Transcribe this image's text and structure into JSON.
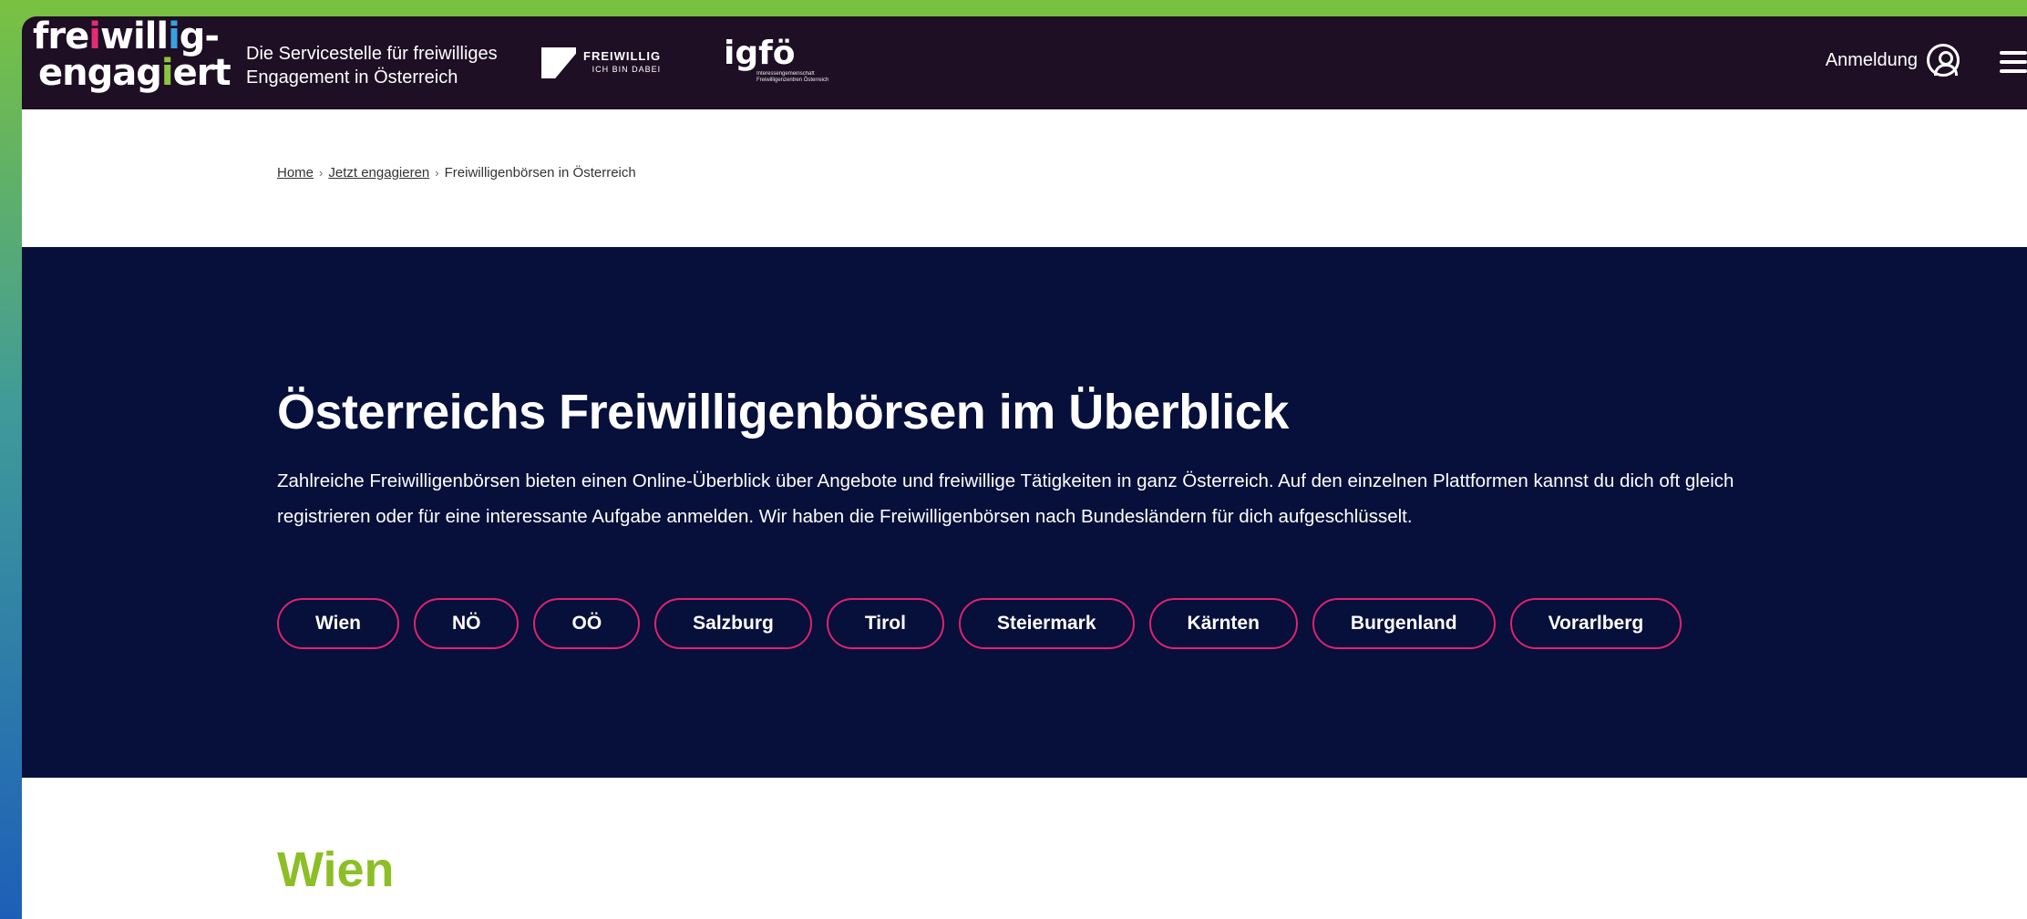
{
  "header": {
    "logo": {
      "line1": "freiwillig-",
      "line2": "engagiert"
    },
    "tagline": {
      "line1": "Die Servicestelle für freiwilliges",
      "line2": "Engagement in Österreich"
    },
    "partner1": {
      "name": "FREIWILLIG",
      "sub": "ICH BIN DABEI"
    },
    "partner2": {
      "name": "igfö",
      "sub": "Interessengemeinschaft Freiwilligenzentren Österreich"
    },
    "login_label": "Anmeldung",
    "icons": {
      "user": "user-circle-icon",
      "menu": "hamburger-menu-icon"
    }
  },
  "breadcrumb": {
    "items": [
      "Home",
      "Jetzt engagieren",
      "Freiwilligenbörsen in Österreich"
    ],
    "separator": "›"
  },
  "hero": {
    "title": "Österreichs Freiwilligenbörsen im Überblick",
    "intro": "Zahlreiche Freiwilligenbörsen bieten einen Online-Überblick über Angebote und freiwillige Tätigkeiten in ganz Österreich. Auf den einzelnen Plattformen kannst du dich oft gleich registrieren oder für eine interessante Aufgabe anmelden. Wir haben die Freiwilligenbörsen nach Bundesländern für dich aufgeschlüsselt.",
    "regions": [
      "Wien",
      "NÖ",
      "OÖ",
      "Salzburg",
      "Tirol",
      "Steiermark",
      "Kärnten",
      "Burgenland",
      "Vorarlberg"
    ]
  },
  "section": {
    "title": "Wien"
  },
  "colors": {
    "header_bg": "#1e0f24",
    "hero_bg": "#06103a",
    "chip_border": "#e0226c",
    "section_title": "#8cbf26"
  }
}
